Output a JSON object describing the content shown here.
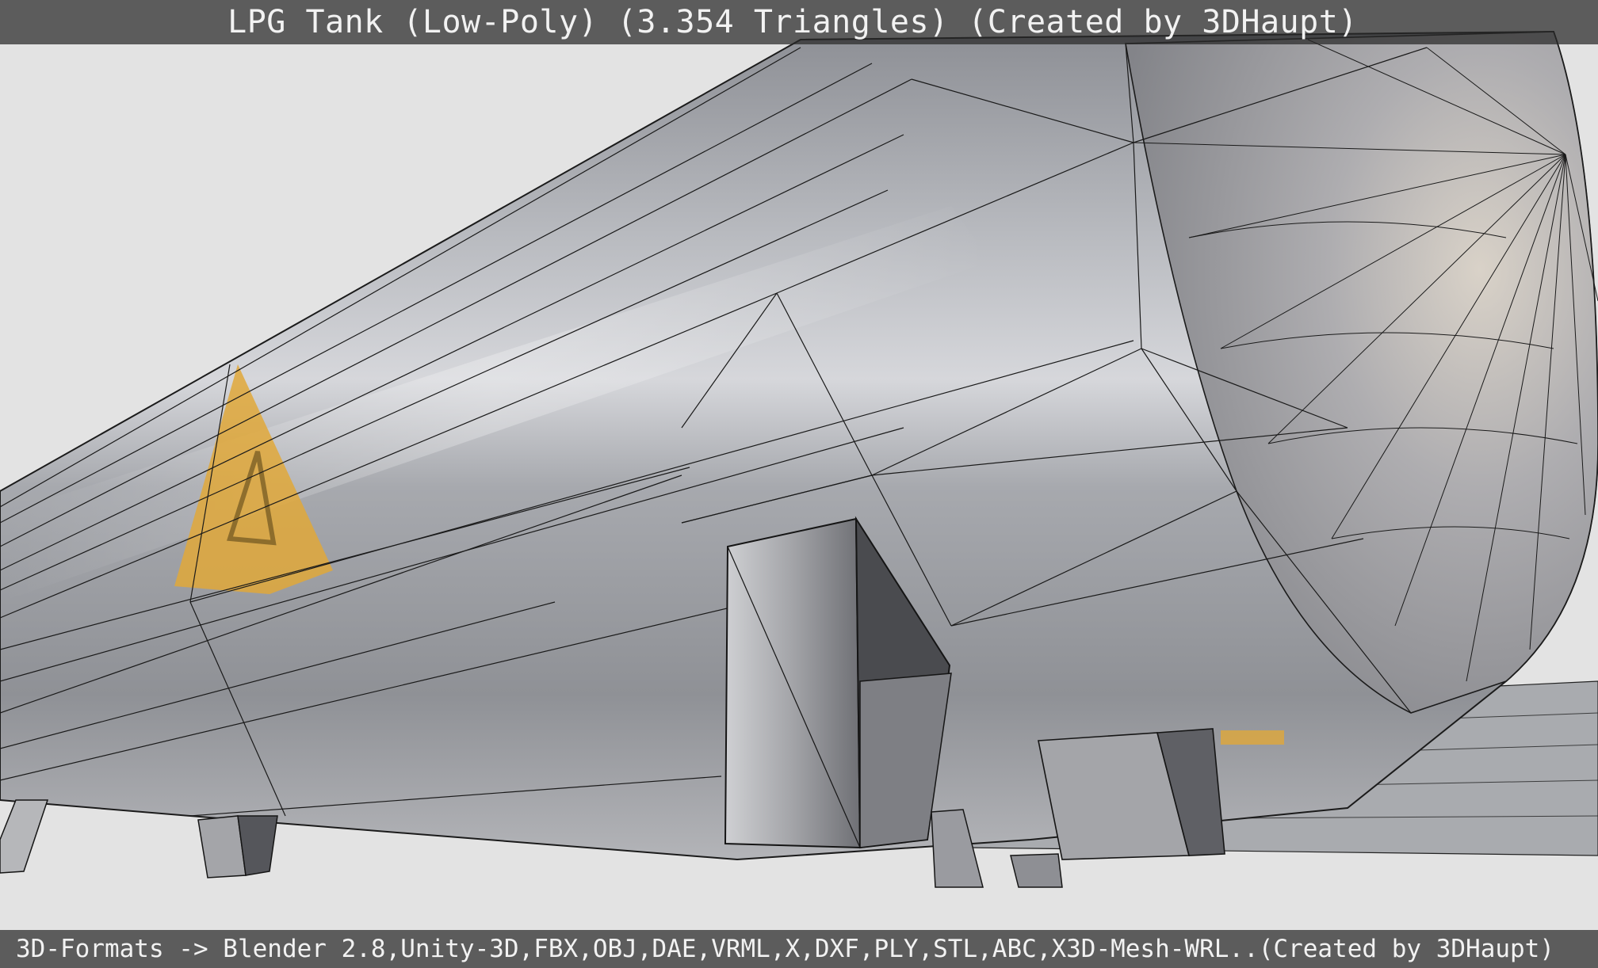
{
  "header": {
    "title": "LPG Tank (Low-Poly) (3.354 Triangles) (Created by 3DHaupt)"
  },
  "footer": {
    "formats": "3D-Formats -> Blender 2.8,Unity-3D,FBX,OBJ,DAE,VRML,X,DXF,PLY,STL,ABC,X3D-Mesh-WRL..(Created by 3DHaupt)"
  },
  "viewport": {
    "background_color": "#e3e3e3",
    "tank_color": "#9a9ca2",
    "warning_label_color": "#e0a83a",
    "wireframe_color": "#1a1a1a"
  }
}
